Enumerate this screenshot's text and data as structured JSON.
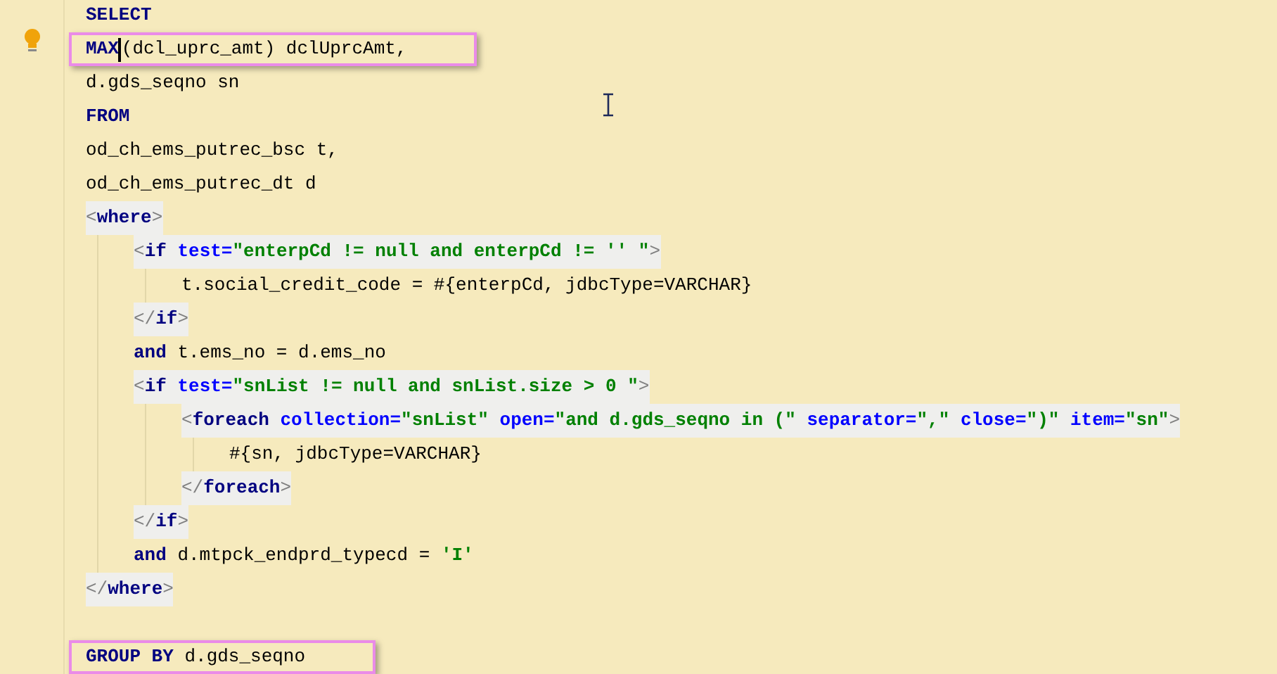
{
  "editor": {
    "lines": [
      {
        "kind": "code",
        "tokens": [
          {
            "t": "SELECT",
            "kind": "kw"
          }
        ]
      },
      {
        "kind": "code",
        "highlighted": true,
        "tokens": [
          {
            "t": "MAX",
            "kind": "kw",
            "caret": true
          },
          {
            "t": "(dcl_uprc_amt) dclUprcAmt,",
            "kind": "plain"
          }
        ]
      },
      {
        "kind": "code",
        "tokens": [
          {
            "t": "d.gds_seqno sn",
            "kind": "plain"
          }
        ]
      },
      {
        "kind": "code",
        "tokens": [
          {
            "t": "FROM",
            "kind": "kw"
          }
        ]
      },
      {
        "kind": "code",
        "tokens": [
          {
            "t": "od_ch_ems_putrec_bsc t,",
            "kind": "plain"
          }
        ]
      },
      {
        "kind": "code",
        "tokens": [
          {
            "t": "od_ch_ems_putrec_dt d",
            "kind": "plain"
          }
        ]
      },
      {
        "kind": "tag",
        "tokens": [
          {
            "t": "<",
            "kind": "br"
          },
          {
            "t": "where",
            "kind": "tag"
          },
          {
            "t": ">",
            "kind": "br"
          }
        ],
        "children": [
          {
            "kind": "tag",
            "tokens": [
              {
                "t": "<",
                "kind": "br"
              },
              {
                "t": "if",
                "kind": "tag"
              },
              {
                "t": " test=",
                "kind": "attr"
              },
              {
                "t": "\"enterpCd != null and enterpCd != '' \"",
                "kind": "str"
              },
              {
                "t": ">",
                "kind": "br"
              }
            ],
            "children": [
              {
                "kind": "code",
                "tokens": [
                  {
                    "t": "t.social_credit_code = #{enterpCd, jdbcType=VARCHAR}",
                    "kind": "plain"
                  }
                ]
              }
            ]
          },
          {
            "kind": "tag",
            "tokens": [
              {
                "t": "</",
                "kind": "br"
              },
              {
                "t": "if",
                "kind": "tag"
              },
              {
                "t": ">",
                "kind": "br"
              }
            ]
          },
          {
            "kind": "code",
            "tokens": [
              {
                "t": "and",
                "kind": "kw"
              },
              {
                "t": " t.ems_no = d.ems_no",
                "kind": "plain"
              }
            ]
          },
          {
            "kind": "tag",
            "tokens": [
              {
                "t": "<",
                "kind": "br"
              },
              {
                "t": "if",
                "kind": "tag"
              },
              {
                "t": " test=",
                "kind": "attr"
              },
              {
                "t": "\"snList != null and snList.size > 0 \"",
                "kind": "str"
              },
              {
                "t": ">",
                "kind": "br"
              }
            ],
            "children": [
              {
                "kind": "tag",
                "tokens": [
                  {
                    "t": "<",
                    "kind": "br"
                  },
                  {
                    "t": "foreach",
                    "kind": "tag"
                  },
                  {
                    "t": " collection=",
                    "kind": "attr"
                  },
                  {
                    "t": "\"snList\"",
                    "kind": "str"
                  },
                  {
                    "t": " open=",
                    "kind": "attr"
                  },
                  {
                    "t": "\"and d.gds_seqno in (\"",
                    "kind": "str"
                  },
                  {
                    "t": " separator=",
                    "kind": "attr"
                  },
                  {
                    "t": "\",\"",
                    "kind": "str"
                  },
                  {
                    "t": " close=",
                    "kind": "attr"
                  },
                  {
                    "t": "\")\"",
                    "kind": "str"
                  },
                  {
                    "t": " item=",
                    "kind": "attr"
                  },
                  {
                    "t": "\"sn\"",
                    "kind": "str"
                  },
                  {
                    "t": ">",
                    "kind": "br"
                  }
                ],
                "children": [
                  {
                    "kind": "code",
                    "tokens": [
                      {
                        "t": "#{sn, jdbcType=VARCHAR}",
                        "kind": "plain"
                      }
                    ]
                  }
                ]
              },
              {
                "kind": "tag",
                "tokens": [
                  {
                    "t": "</",
                    "kind": "br"
                  },
                  {
                    "t": "foreach",
                    "kind": "tag"
                  },
                  {
                    "t": ">",
                    "kind": "br"
                  }
                ]
              }
            ]
          },
          {
            "kind": "tag",
            "tokens": [
              {
                "t": "</",
                "kind": "br"
              },
              {
                "t": "if",
                "kind": "tag"
              },
              {
                "t": ">",
                "kind": "br"
              }
            ]
          },
          {
            "kind": "code",
            "tokens": [
              {
                "t": "and",
                "kind": "kw"
              },
              {
                "t": " d.mtpck_endprd_typecd = ",
                "kind": "plain"
              },
              {
                "t": "'I'",
                "kind": "str"
              }
            ]
          }
        ]
      },
      {
        "kind": "tag",
        "tokens": [
          {
            "t": "</",
            "kind": "br"
          },
          {
            "t": "where",
            "kind": "tag"
          },
          {
            "t": ">",
            "kind": "br"
          }
        ]
      },
      {
        "kind": "code",
        "gap_before": true,
        "highlighted": true,
        "tokens": [
          {
            "t": "GROUP BY",
            "kind": "kw"
          },
          {
            "t": " d.gds_seqno",
            "kind": "plain"
          }
        ]
      }
    ]
  }
}
